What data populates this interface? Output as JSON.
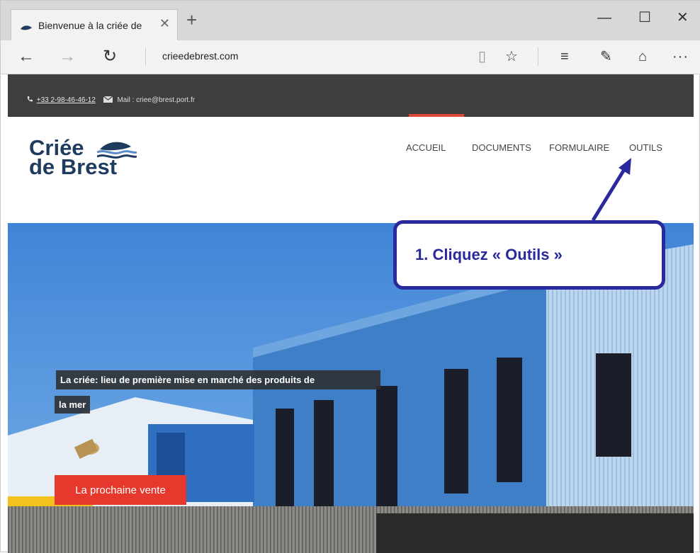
{
  "browser": {
    "tab_title": "Bienvenue à la criée de",
    "tab_close": "✕",
    "new_tab": "+",
    "window_controls": {
      "minimize": "—",
      "maximize": "☐",
      "close": "✕"
    },
    "nav": {
      "back": "←",
      "forward": "→",
      "refresh": "↻"
    },
    "url": "crieedebrest.com",
    "toolbar": {
      "reading_view": "▯",
      "favorite": "☆",
      "hub": "≡",
      "web_note": "✎",
      "share": "⌂",
      "more": "···"
    }
  },
  "site": {
    "contact": {
      "phone": "+33 2-98-46-46-12",
      "mail": "Mail : criee@brest.port.fr"
    },
    "logo": {
      "line1": "Criée",
      "line2": "de Brest"
    },
    "menu": [
      "ACCUEIL",
      "DOCUMENTS",
      "FORMULAIRE",
      "OUTILS"
    ],
    "hero": {
      "tagline_line1": "La criée: lieu de première mise en marché des produits de",
      "tagline_line2": "la mer",
      "cta": "La prochaine vente"
    }
  },
  "annotation": {
    "text": "1. Cliquez « Outils »",
    "color": "#2a2a9e"
  },
  "colors": {
    "accent": "#e6382c",
    "logo": "#1f3b5e",
    "topstrip": "#3e3e3e",
    "sky": "#4a8bd6"
  }
}
